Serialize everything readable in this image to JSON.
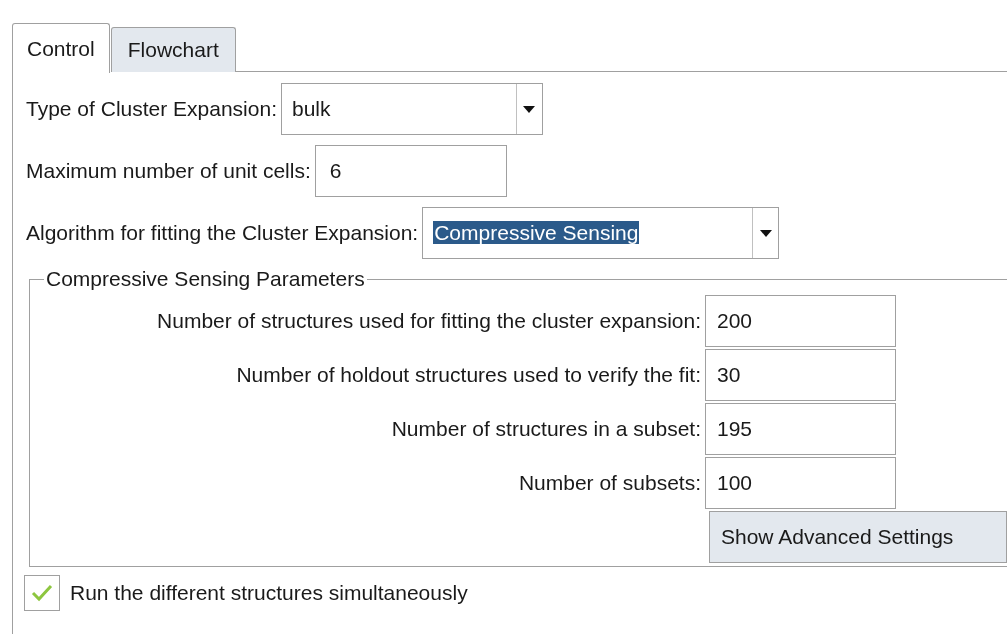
{
  "tabs": [
    {
      "label": "Control",
      "selected": true
    },
    {
      "label": "Flowchart",
      "selected": false
    }
  ],
  "fields": [
    {
      "kind": "dropdown",
      "label": "Type of Cluster Expansion:",
      "value": "bulk",
      "text_selected": false
    },
    {
      "kind": "text",
      "label": "Maximum number of unit cells:",
      "value": "6"
    },
    {
      "kind": "dropdown",
      "label": "Algorithm for fitting the Cluster Expansion:",
      "value": "Compressive Sensing",
      "text_selected": true
    }
  ],
  "group": {
    "title": "Compressive Sensing Parameters",
    "rows": [
      {
        "label": "Number of structures used for fitting the cluster expansion:",
        "value": "200"
      },
      {
        "label": "Number of holdout structures used to verify the fit:",
        "value": "30"
      },
      {
        "label": "Number of structures in a subset:",
        "value": "195"
      },
      {
        "label": "Number of subsets:",
        "value": "100"
      }
    ],
    "button": "Show Advanced Settings"
  },
  "checkbox": {
    "label": "Run the different structures simultaneously",
    "checked": true
  }
}
